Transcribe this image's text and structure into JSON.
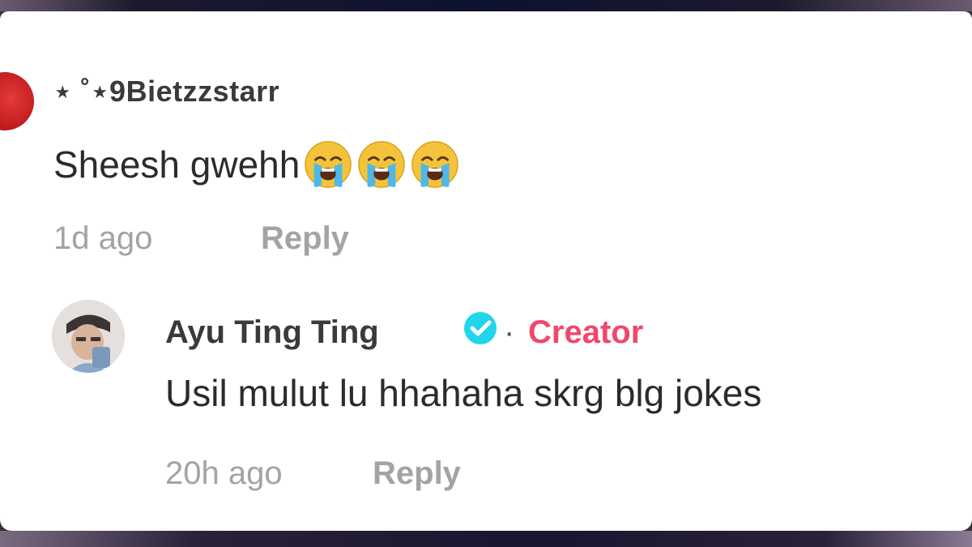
{
  "comments": [
    {
      "username": "⋆ ˚⋆9Bietzzstarr",
      "text": "Sheesh gwehh",
      "emojis": [
        "loudly-crying-face",
        "loudly-crying-face",
        "loudly-crying-face"
      ],
      "time": "1d ago",
      "reply_label": "Reply",
      "avatar_color": "#d42a2c"
    }
  ],
  "reply": {
    "username": "Ayu Ting Ting",
    "verified": true,
    "separator": "·",
    "badge": "Creator",
    "text": "Usil mulut lu hhahaha skrg blg jokes",
    "time": "20h ago",
    "reply_label": "Reply",
    "badge_color": "#f0476a",
    "verified_color": "#20d5ec"
  }
}
